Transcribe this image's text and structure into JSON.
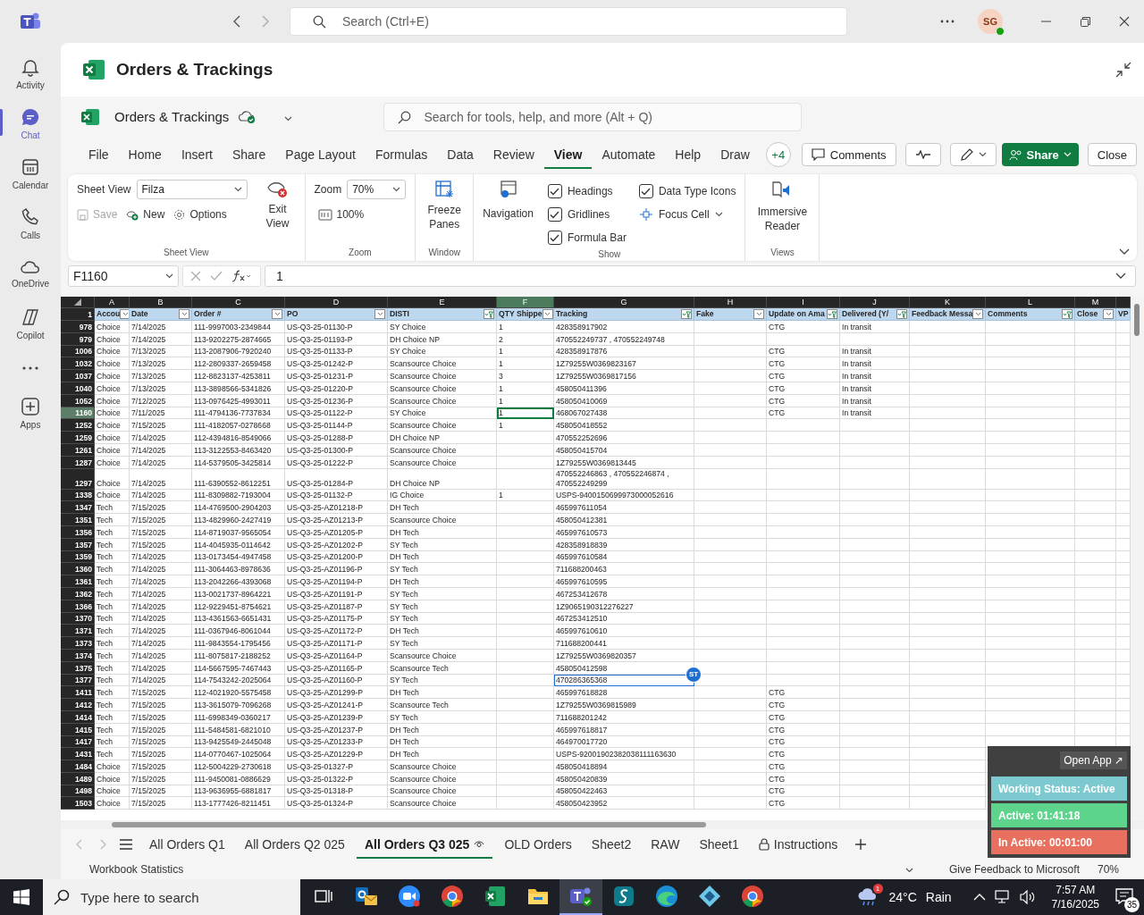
{
  "teams": {
    "search": {
      "placeholder": "Search (Ctrl+E)"
    },
    "avatar": "SG"
  },
  "rail": [
    {
      "kind": "bell",
      "label": "Activity",
      "selected": false
    },
    {
      "kind": "chat",
      "label": "Chat",
      "selected": true
    },
    {
      "kind": "calendar",
      "label": "Calendar",
      "selected": false
    },
    {
      "kind": "phone",
      "label": "Calls",
      "selected": false
    },
    {
      "kind": "cloud",
      "label": "OneDrive",
      "selected": false
    },
    {
      "kind": "copilot",
      "label": "Copilot",
      "selected": false
    },
    {
      "kind": "more",
      "selected": false
    },
    {
      "kind": "plus",
      "label": "Apps",
      "selected": false
    }
  ],
  "app_header": {
    "title": "Orders & Trackings"
  },
  "excel": {
    "file_name": "Orders & Trackings",
    "search": {
      "placeholder": "Search for tools, help, and more (Alt + Q)"
    },
    "menu": [
      {
        "label": "File",
        "selected": false
      },
      {
        "label": "Home",
        "selected": false
      },
      {
        "label": "Insert",
        "selected": false
      },
      {
        "label": "Share",
        "selected": false
      },
      {
        "label": "Page Layout",
        "selected": false
      },
      {
        "label": "Formulas",
        "selected": false
      },
      {
        "label": "Data",
        "selected": false
      },
      {
        "label": "Review",
        "selected": false
      },
      {
        "label": "View",
        "selected": true
      },
      {
        "label": "Automate",
        "selected": false
      },
      {
        "label": "Help",
        "selected": false
      },
      {
        "label": "Draw",
        "selected": false
      }
    ],
    "collaborators": "+4",
    "comments": "Comments",
    "share": "Share",
    "close": "Close",
    "ribbon": [
      {
        "kind": "sheet_view",
        "title": "Sheet View",
        "view_label": "Sheet View",
        "view_value": "Filza",
        "buttons": [
          {
            "label": "Save",
            "disabled": true
          },
          {
            "label": "New",
            "disabled": false
          },
          {
            "label": "Options",
            "disabled": false
          }
        ],
        "exit": "Exit View"
      },
      {
        "kind": "zoom",
        "title": "Zoom",
        "zoom_label": "Zoom",
        "zoom_value": "70%",
        "reset": "100%"
      },
      {
        "kind": "window",
        "title": "Window",
        "freeze": "Freeze Panes"
      },
      {
        "kind": "show",
        "title": "Show",
        "navigation": "Navigation",
        "checks": [
          {
            "label": "Headings",
            "checked": true
          },
          {
            "label": "Gridlines",
            "checked": true
          },
          {
            "label": "Formula Bar",
            "checked": true
          },
          {
            "label": "Data Type Icons",
            "checked": true
          }
        ],
        "focus": "Focus Cell"
      },
      {
        "kind": "views",
        "title": "Views",
        "reader": "Immersive Reader"
      }
    ],
    "formula_bar": {
      "name_box": "F1160",
      "value": "1"
    },
    "sheet": {
      "columns": [
        {
          "letter": "A",
          "header": "Accou",
          "filtered": false,
          "selected": false
        },
        {
          "letter": "B",
          "header": "Date",
          "filtered": false,
          "selected": false
        },
        {
          "letter": "C",
          "header": "Order #",
          "filtered": false,
          "selected": false
        },
        {
          "letter": "D",
          "header": "PO",
          "filtered": false,
          "selected": false
        },
        {
          "letter": "E",
          "header": "DISTI",
          "filtered": true,
          "selected": false
        },
        {
          "letter": "F",
          "header": "QTY Shippe",
          "filtered": false,
          "selected": true
        },
        {
          "letter": "G",
          "header": "Tracking",
          "filtered": true,
          "selected": false
        },
        {
          "letter": "H",
          "header": "Fake",
          "filtered": false,
          "selected": false
        },
        {
          "letter": "I",
          "header": "Update on Ama",
          "filtered": true,
          "selected": false
        },
        {
          "letter": "J",
          "header": "Delivered (Y/",
          "filtered": true,
          "selected": false
        },
        {
          "letter": "K",
          "header": "Feedback Messa",
          "filtered": false,
          "selected": false
        },
        {
          "letter": "L",
          "header": "Comments",
          "filtered": true,
          "selected": false
        },
        {
          "letter": "M",
          "header": "Close",
          "filtered": false,
          "selected": false
        },
        {
          "header": "VP",
          "selected": false
        }
      ],
      "header_row": "1",
      "rows": [
        {
          "row": "978",
          "A": "Choice",
          "B": "7/14/2025",
          "C": "111-9997003-2349844",
          "D": "US-Q3-25-01130-P",
          "E": "SY Choice",
          "F": "1",
          "G": "428358917902",
          "I": "CTG",
          "J": "In transit",
          "selected": false
        },
        {
          "row": "979",
          "A": "Choice",
          "B": "7/14/2025",
          "C": "113-9202275-2874665",
          "D": "US-Q3-25-01193-P",
          "E": "DH Choice NP",
          "F": "2",
          "G": "470552249737 , 470552249748",
          "selected": false
        },
        {
          "row": "1006",
          "A": "Choice",
          "B": "7/13/2025",
          "C": "113-2087906-7920240",
          "D": "US-Q3-25-01133-P",
          "E": "SY Choice",
          "F": "1",
          "G": "428358917876",
          "I": "CTG",
          "J": "In transit",
          "selected": false
        },
        {
          "row": "1032",
          "A": "Choice",
          "B": "7/13/2025",
          "C": "112-2809337-2659458",
          "D": "US-Q3-25-01242-P",
          "E": "Scansource Choice",
          "F": "1",
          "G": "1Z79255W0369823167",
          "I": "CTG",
          "J": "In transit",
          "selected": false
        },
        {
          "row": "1037",
          "A": "Choice",
          "B": "7/13/2025",
          "C": "112-8823137-4253811",
          "D": "US-Q3-25-01231-P",
          "E": "Scansource Choice",
          "F": "3",
          "G": "1Z79255W0369817156",
          "I": "CTG",
          "J": "In transit",
          "selected": false
        },
        {
          "row": "1040",
          "A": "Choice",
          "B": "7/13/2025",
          "C": "113-3898566-5341826",
          "D": "US-Q3-25-01220-P",
          "E": "Scansource Choice",
          "F": "1",
          "G": "458050411396",
          "I": "CTG",
          "J": "In transit",
          "selected": false
        },
        {
          "row": "1052",
          "A": "Choice",
          "B": "7/12/2025",
          "C": "113-0976425-4993011",
          "D": "US-Q3-25-01236-P",
          "E": "Scansource Choice",
          "F": "1",
          "G": "458050410069",
          "I": "CTG",
          "J": "In transit",
          "selected": false
        },
        {
          "row": "1160",
          "A": "Choice",
          "B": "7/11/2025",
          "C": "111-4794136-7737834",
          "D": "US-Q3-25-01122-P",
          "E": "SY Choice",
          "F": "1",
          "G": "468067027438",
          "I": "CTG",
          "J": "In transit",
          "selected": true
        },
        {
          "row": "1252",
          "A": "Choice",
          "B": "7/15/2025",
          "C": "111-4182057-0278668",
          "D": "US-Q3-25-01144-P",
          "E": "Scansource Choice",
          "F": "1",
          "G": "458050418552",
          "selected": false
        },
        {
          "row": "1259",
          "A": "Choice",
          "B": "7/14/2025",
          "C": "112-4394816-8549066",
          "D": "US-Q3-25-01288-P",
          "E": "DH Choice NP",
          "G": "470552252696",
          "selected": false
        },
        {
          "row": "1261",
          "A": "Choice",
          "B": "7/14/2025",
          "C": "113-3122553-8463420",
          "D": "US-Q3-25-01300-P",
          "E": "Scansource Choice",
          "G": "458050415704",
          "selected": false
        },
        {
          "row": "1287",
          "A": "Choice",
          "B": "7/14/2025",
          "C": "114-5379505-3425814",
          "D": "US-Q3-25-01222-P",
          "E": "Scansource Choice",
          "G": "1Z79255W0369813445",
          "selected": false
        },
        {
          "row": "1297",
          "A": "Choice",
          "B": "7/14/2025",
          "C": "111-6390552-8612251",
          "D": "US-Q3-25-01284-P",
          "E": "DH Choice NP",
          "G": "470552246863 , 470552246874 , 470552249299",
          "selected": false
        },
        {
          "row": "1338",
          "A": "Choice",
          "B": "7/14/2025",
          "C": "111-8309882-7193004",
          "D": "US-Q3-25-01132-P",
          "E": "IG Choice",
          "F": "1",
          "G": "USPS-9400150699973000052616",
          "selected": false
        },
        {
          "row": "1347",
          "A": "Tech",
          "B": "7/15/2025",
          "C": "114-4769500-2904203",
          "D": "US-Q3-25-AZ01218-P",
          "E": "DH Tech",
          "G": "465997611054",
          "selected": false
        },
        {
          "row": "1351",
          "A": "Tech",
          "B": "7/15/2025",
          "C": "113-4829960-2427419",
          "D": "US-Q3-25-AZ01213-P",
          "E": "Scansource Choice",
          "G": "458050412381",
          "selected": false
        },
        {
          "row": "1356",
          "A": "Tech",
          "B": "7/15/2025",
          "C": "114-8719037-9565054",
          "D": "US-Q3-25-AZ01205-P",
          "E": "DH Tech",
          "G": "465997610573",
          "selected": false
        },
        {
          "row": "1357",
          "A": "Tech",
          "B": "7/15/2025",
          "C": "114-4045935-0114642",
          "D": "US-Q3-25-AZ01202-P",
          "E": "SY Tech",
          "G": "428358918839",
          "selected": false
        },
        {
          "row": "1359",
          "A": "Tech",
          "B": "7/14/2025",
          "C": "113-0173454-4947458",
          "D": "US-Q3-25-AZ01200-P",
          "E": "DH Tech",
          "G": "465997610584",
          "selected": false
        },
        {
          "row": "1360",
          "A": "Tech",
          "B": "7/14/2025",
          "C": "111-3064463-8978636",
          "D": "US-Q3-25-AZ01196-P",
          "E": "SY Tech",
          "G": "711688200463",
          "selected": false
        },
        {
          "row": "1361",
          "A": "Tech",
          "B": "7/14/2025",
          "C": "113-2042266-4393068",
          "D": "US-Q3-25-AZ01194-P",
          "E": "DH Tech",
          "G": "465997610595",
          "selected": false
        },
        {
          "row": "1362",
          "A": "Tech",
          "B": "7/14/2025",
          "C": "113-0021737-8964221",
          "D": "US-Q3-25-AZ01191-P",
          "E": "SY Tech",
          "G": "467253412678",
          "selected": false
        },
        {
          "row": "1366",
          "A": "Tech",
          "B": "7/14/2025",
          "C": "112-9229451-8754621",
          "D": "US-Q3-25-AZ01187-P",
          "E": "SY Tech",
          "G": "1Z9065190312276227",
          "selected": false
        },
        {
          "row": "1370",
          "A": "Tech",
          "B": "7/14/2025",
          "C": "113-4361563-6651431",
          "D": "US-Q3-25-AZ01175-P",
          "E": "SY Tech",
          "G": "467253412510",
          "selected": false
        },
        {
          "row": "1371",
          "A": "Tech",
          "B": "7/14/2025",
          "C": "111-0367946-8061044",
          "D": "US-Q3-25-AZ01172-P",
          "E": "DH Tech",
          "G": "465997610610",
          "selected": false
        },
        {
          "row": "1373",
          "A": "Tech",
          "B": "7/14/2025",
          "C": "111-9843554-1795456",
          "D": "US-Q3-25-AZ01171-P",
          "E": "SY Tech",
          "G": "711688200441",
          "selected": false
        },
        {
          "row": "1374",
          "A": "Tech",
          "B": "7/14/2025",
          "C": "111-8075817-2188252",
          "D": "US-Q3-25-AZ01164-P",
          "E": "Scansource Choice",
          "G": "1Z79255W0369820357",
          "selected": false
        },
        {
          "row": "1375",
          "A": "Tech",
          "B": "7/14/2025",
          "C": "114-5667595-7467443",
          "D": "US-Q3-25-AZ01165-P",
          "E": "Scansource Tech",
          "G": "458050412598",
          "selected": false
        },
        {
          "row": "1377",
          "A": "Tech",
          "B": "7/14/2025",
          "C": "114-7543242-2025064",
          "D": "US-Q3-25-AZ01160-P",
          "E": "SY Tech",
          "G": {
            "value": "470286365368",
            "collaborator": "ST"
          },
          "selected": false
        },
        {
          "row": "1411",
          "A": "Tech",
          "B": "7/15/2025",
          "C": "112-4021920-5575458",
          "D": "US-Q3-25-AZ01299-P",
          "E": "DH Tech",
          "G": "465997618828",
          "I": "CTG",
          "selected": false
        },
        {
          "row": "1412",
          "A": "Tech",
          "B": "7/15/2025",
          "C": "113-3615079-7096268",
          "D": "US-Q3-25-AZ01241-P",
          "E": "Scansource Tech",
          "G": "1Z79255W0369815989",
          "I": "CTG",
          "selected": false
        },
        {
          "row": "1414",
          "A": "Tech",
          "B": "7/15/2025",
          "C": "111-6998349-0360217",
          "D": "US-Q3-25-AZ01239-P",
          "E": "SY Tech",
          "G": "711688201242",
          "I": "CTG",
          "selected": false
        },
        {
          "row": "1415",
          "A": "Tech",
          "B": "7/15/2025",
          "C": "111-5484581-6821010",
          "D": "US-Q3-25-AZ01237-P",
          "E": "DH Tech",
          "G": "465997618817",
          "I": "CTG",
          "selected": false
        },
        {
          "row": "1417",
          "A": "Tech",
          "B": "7/15/2025",
          "C": "113-9425549-2445048",
          "D": "US-Q3-25-AZ01233-P",
          "E": "DH Tech",
          "G": "464970017720",
          "I": "CTG",
          "selected": false
        },
        {
          "row": "1431",
          "A": "Tech",
          "B": "7/15/2025",
          "C": "114-0770467-1025064",
          "D": "US-Q3-25-AZ01229-P",
          "E": "DH Tech",
          "G": "USPS-92001902382038111163630",
          "I": "CTG",
          "selected": false
        },
        {
          "row": "1484",
          "A": "Choice",
          "B": "7/15/2025",
          "C": "112-5004229-2730618",
          "D": "US-Q3-25-01327-P",
          "E": "Scansource Choice",
          "G": "458050418894",
          "I": "CTG",
          "selected": false
        },
        {
          "row": "1489",
          "A": "Choice",
          "B": "7/15/2025",
          "C": "111-9450081-0886629",
          "D": "US-Q3-25-01322-P",
          "E": "Scansource Choice",
          "G": "458050420839",
          "I": "CTG",
          "selected": false
        },
        {
          "row": "1498",
          "A": "Choice",
          "B": "7/15/2025",
          "C": "113-9636955-6881817",
          "D": "US-Q3-25-01318-P",
          "E": "Scansource Choice",
          "G": "458050422463",
          "I": "CTG",
          "selected": false
        },
        {
          "row": "1503",
          "A": "Choice",
          "B": "7/15/2025",
          "C": "113-1777426-8211451",
          "D": "US-Q3-25-01324-P",
          "E": "Scansource Choice",
          "G": "458050423952",
          "I": "CTG",
          "selected": false
        }
      ]
    },
    "sheet_tabs": [
      {
        "label": "All Orders Q1",
        "selected": false,
        "viewing": false,
        "locked": false
      },
      {
        "label": "All Orders Q2 025",
        "selected": false,
        "viewing": false,
        "locked": false
      },
      {
        "label": "All Orders Q3 025",
        "selected": true,
        "viewing": true,
        "locked": false
      },
      {
        "label": "OLD Orders",
        "selected": false,
        "viewing": false,
        "locked": false
      },
      {
        "label": "Sheet2",
        "selected": false,
        "viewing": false,
        "locked": false
      },
      {
        "label": "RAW",
        "selected": false,
        "viewing": false,
        "locked": false
      },
      {
        "label": "Sheet1",
        "selected": false,
        "viewing": false,
        "locked": false
      },
      {
        "label": "Instructions",
        "selected": false,
        "viewing": false,
        "locked": true
      }
    ],
    "status_bar": {
      "left": "Workbook Statistics",
      "feedback": "Give Feedback to Microsoft",
      "zoom": "70%"
    }
  },
  "tracker": {
    "open": "Open App ↗",
    "items": [
      {
        "label": "Working Status: Active",
        "color": "#7dc9d0"
      },
      {
        "label": "Active: 01:41:18",
        "color": "#5dd38b"
      },
      {
        "label": "In Active: 00:01:00",
        "color": "#e8705e"
      }
    ]
  },
  "taskbar": {
    "search": {
      "placeholder": "Type here to search"
    },
    "apps": [
      {
        "kind": "taskview",
        "selected": false
      },
      {
        "kind": "mail",
        "selected": false
      },
      {
        "kind": "video",
        "selected": false
      },
      {
        "kind": "browser",
        "selected": false
      },
      {
        "kind": "sheet",
        "selected": false
      },
      {
        "kind": "folder",
        "selected": false
      },
      {
        "kind": "people",
        "selected": true
      },
      {
        "kind": "swoosh",
        "selected": false
      },
      {
        "kind": "wave",
        "selected": false
      },
      {
        "kind": "diamond",
        "selected": false
      },
      {
        "kind": "browser",
        "selected": false
      }
    ],
    "weather_badge": "1",
    "temperature": "24°C",
    "weather": "Rain",
    "time": "7:57 AM",
    "date": "7/16/2025",
    "notifications": "35"
  }
}
